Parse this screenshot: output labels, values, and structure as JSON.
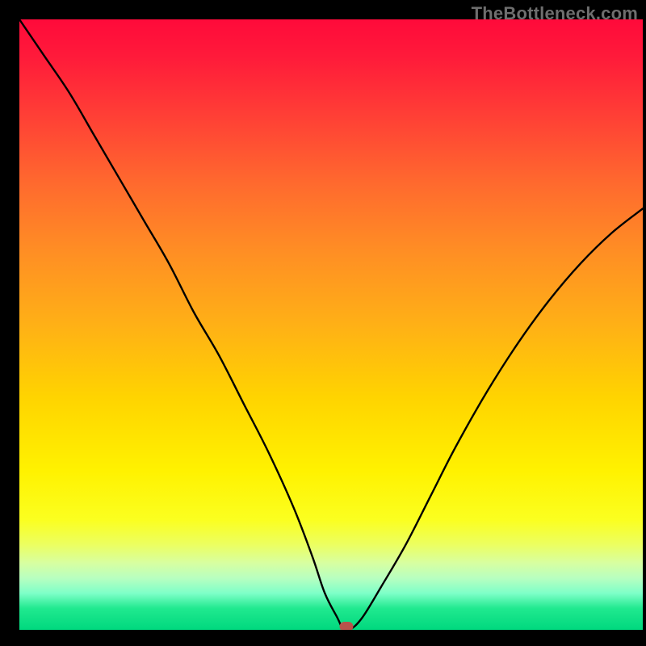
{
  "watermark": "TheBottleneck.com",
  "chart_data": {
    "type": "line",
    "title": "",
    "xlabel": "",
    "ylabel": "",
    "xlim": [
      0,
      100
    ],
    "ylim": [
      0,
      100
    ],
    "x": [
      0,
      4,
      8,
      12,
      16,
      20,
      24,
      28,
      32,
      36,
      40,
      44,
      47,
      49,
      51,
      52,
      53,
      55,
      58,
      62,
      66,
      70,
      75,
      80,
      85,
      90,
      95,
      100
    ],
    "values": [
      100,
      94,
      88,
      81,
      74,
      67,
      60,
      52,
      45,
      37,
      29,
      20,
      12,
      6,
      2,
      0,
      0,
      2,
      7,
      14,
      22,
      30,
      39,
      47,
      54,
      60,
      65,
      69
    ],
    "marker": {
      "x": 52.5,
      "y": 0
    },
    "background_gradient": {
      "top": "#ff0a3a",
      "mid": "#ffd400",
      "bottom": "#00d87e"
    }
  }
}
